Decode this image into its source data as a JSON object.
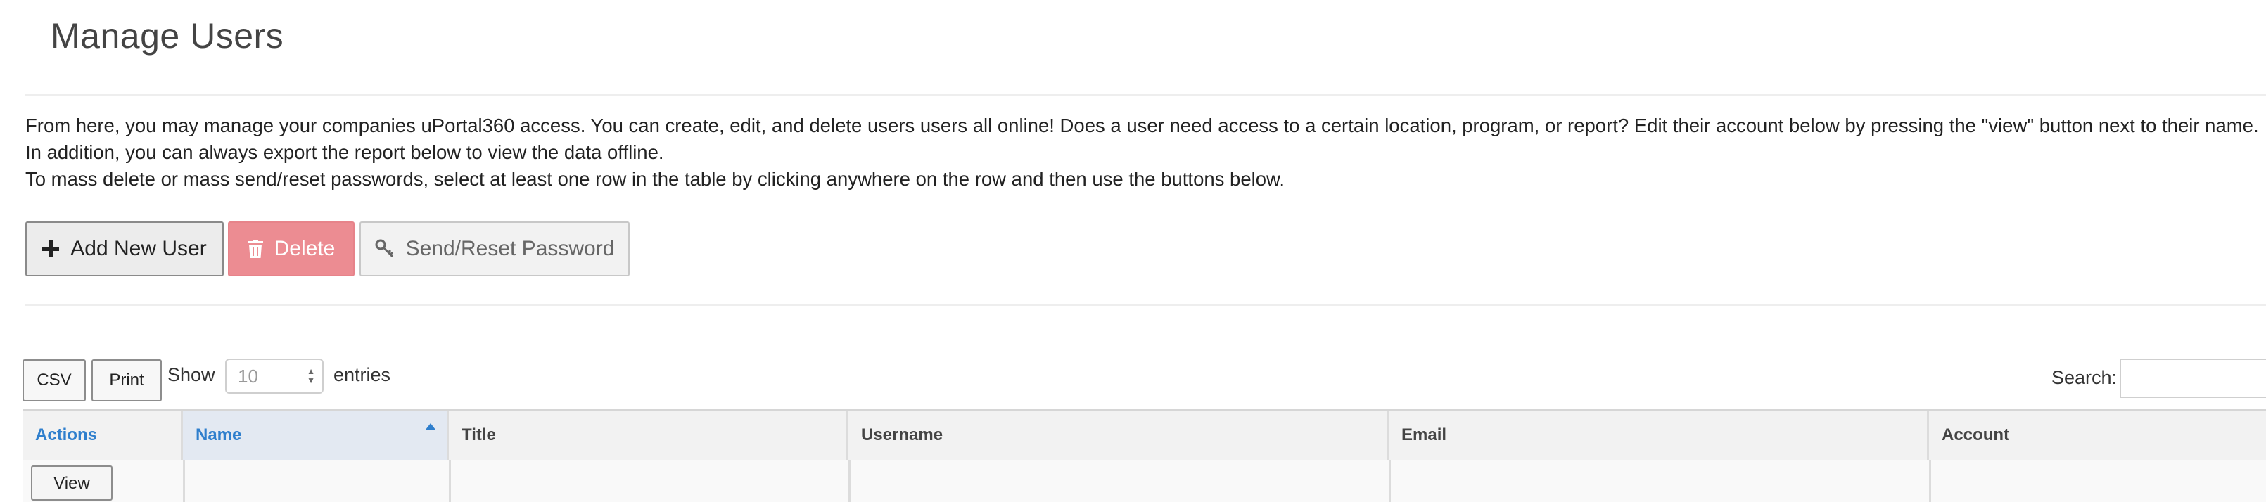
{
  "page": {
    "title": "Manage Users",
    "intro_line1": "From here, you may manage your companies uPortal360 access. You can create, edit, and delete users users all online! Does a user need access to a certain location, program, or report? Edit their account below by pressing the \"view\" button next to their name. In addition, you can always export the report below to view the data offline.",
    "intro_line2": "To mass delete or mass send/reset passwords, select at least one row in the table by clicking anywhere on the row and then use the buttons below."
  },
  "toolbar": {
    "add_label": "Add New User",
    "delete_label": "Delete",
    "reset_label": "Send/Reset Password"
  },
  "table_controls": {
    "csv_label": "CSV",
    "print_label": "Print",
    "show_label": "Show",
    "page_size": "10",
    "entries_label": "entries",
    "search_label": "Search:"
  },
  "table": {
    "columns": [
      "Actions",
      "Name",
      "Title",
      "Username",
      "Email",
      "Account"
    ],
    "row_action_label": "View"
  },
  "colors": {
    "accent_blue": "#2f7fcd",
    "delete_red": "#ec8c92"
  }
}
